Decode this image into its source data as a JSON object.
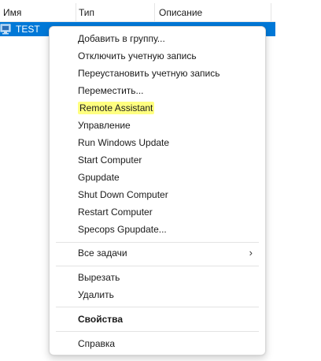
{
  "list": {
    "columns": [
      "Имя",
      "Тип",
      "Описание"
    ],
    "selected_row": {
      "name": "TEST",
      "icon": "computer-icon"
    }
  },
  "menu": {
    "items": [
      "Добавить в группу...",
      "Отключить учетную запись",
      "Переустановить учетную запись",
      "Переместить...",
      "Remote Assistant",
      "Управление",
      "Run Windows Update",
      "Start Computer",
      "Gpupdate",
      "Shut Down Computer",
      "Restart Computer",
      "Specops Gpupdate..."
    ],
    "all_tasks": "Все задачи",
    "cut": "Вырезать",
    "delete": "Удалить",
    "properties": "Свойства",
    "help": "Справка",
    "highlight_color": "#ffff80",
    "selection_color": "#0078d7"
  }
}
